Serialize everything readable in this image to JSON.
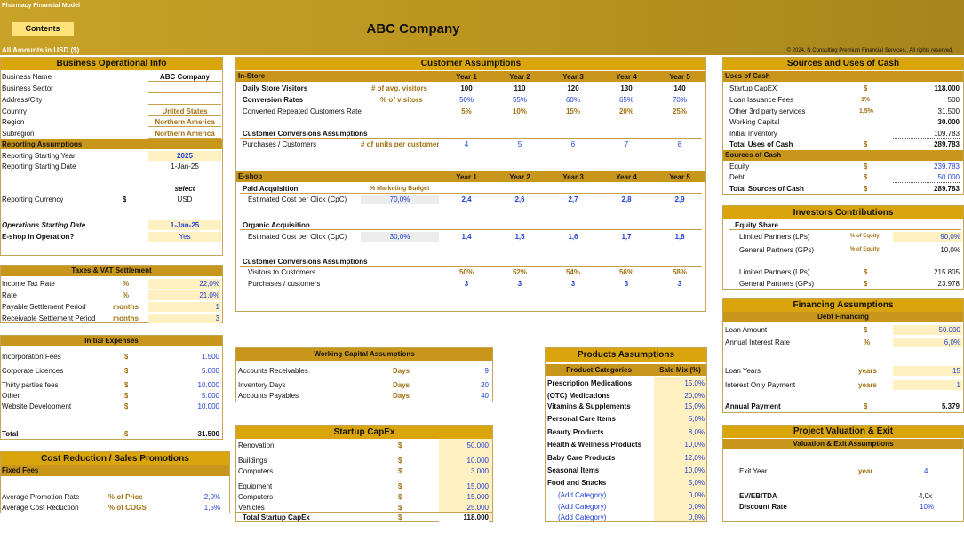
{
  "header": {
    "model_title": "Pharmacy Financial Model",
    "contents_btn": "Contents",
    "company": "ABC Company",
    "currency_note": "All Amounts in  USD ($)",
    "copyright": "© 2024, N Consulting Premium Financial Services.. All rights reserved."
  },
  "bop": {
    "title": "Business Operational Info",
    "l1": "Business Name",
    "v1": "ABC Company",
    "l2": "Business Sector",
    "l3": "Address/City",
    "l4": "Country",
    "v4": "United States",
    "l5": "Region",
    "v5": "Northern America",
    "l6": "Subregion",
    "v6": "Northern America",
    "rep_hdr": "Reporting Assumptions",
    "l7": "Reporting Starting Year",
    "v7": "2025",
    "l8": "Reporting Starting Date",
    "v8": "1-Jan-25",
    "select": "select",
    "l9": "Reporting Currency",
    "sym9": "$",
    "v9": "USD",
    "l10": "Operations Starting Date",
    "v10": "1-Jan-25",
    "l11": "E-shop in Operation?",
    "v11": "Yes"
  },
  "tax": {
    "title": "Taxes & VAT Settlement",
    "l1": "Income Tax Rate",
    "u1": "%",
    "v1": "22,0%",
    "l2": "Rate",
    "u2": "%",
    "v2": "21,0%",
    "l3": "Payable Settlement Period",
    "u3": "months",
    "v3": "1",
    "l4": "Receivable Settlement Period",
    "u4": "months",
    "v4": "3"
  },
  "ie": {
    "title": "Initial Expenses",
    "l1": "Incorporation Fees",
    "s1": "$",
    "v1": "1.500",
    "l2": "Corporate Licences",
    "s2": "$",
    "v2": "5.000",
    "l3": "Thirty parties fees",
    "s3": "$",
    "v3": "10.000",
    "l4": "Other",
    "s4": "$",
    "v4": "5.000",
    "l5": "Website Development",
    "s5": "$",
    "v5": "10.000",
    "total_label": "Total",
    "total_sym": "$",
    "total": "31.500"
  },
  "cr": {
    "title": "Cost Reduction / Sales Promotions",
    "sub": "Fixed Fees",
    "l1": "Average Promotion Rate",
    "u1": "% of Price",
    "v1": "2,0%",
    "l2": "Average Cost Reduction",
    "u2": "% of COGS",
    "v2": "1,5%"
  },
  "ca": {
    "title": "Customer Assumptions",
    "instore": "In-Store",
    "years": [
      "Year 1",
      "Year 2",
      "Year 3",
      "Year 4",
      "Year 5"
    ],
    "r1": {
      "label": "Daily Store Visitors",
      "unit": "# of  avg. visitors",
      "vals": [
        "100",
        "110",
        "120",
        "130",
        "140"
      ]
    },
    "r2": {
      "label": "Conversion Rates",
      "unit": "% of visitors",
      "vals": [
        "50%",
        "55%",
        "60%",
        "65%",
        "70%"
      ]
    },
    "r3": {
      "label": "Converted Repeated Customers Rate",
      "vals": [
        "5%",
        "10%",
        "15%",
        "20%",
        "25%"
      ]
    },
    "cca": "Customer Conversions Assumptions",
    "r4": {
      "label": "Purchases / Customers",
      "unit": "# of units per customer",
      "vals": [
        "4",
        "5",
        "6",
        "7",
        "8"
      ]
    },
    "eshop": "E-shop",
    "paid": "Paid Acquisition",
    "pct_budget": "% Marketing Budget",
    "r5": {
      "label": "Estimated Cost per Click (CpC)",
      "pct": "70,0%",
      "vals": [
        "2,4",
        "2,6",
        "2,7",
        "2,8",
        "2,9"
      ]
    },
    "organic": "Organic Acquisition",
    "r6": {
      "label": "Estimated Cost per Click (CpC)",
      "pct": "30,0%",
      "vals": [
        "1,4",
        "1,5",
        "1,6",
        "1,7",
        "1,8"
      ]
    },
    "cca2": "Customer Conversions Assumptions",
    "r7": {
      "label": "Visitors to Customers",
      "vals": [
        "50%",
        "52%",
        "54%",
        "56%",
        "58%"
      ]
    },
    "r8": {
      "label": "Purchases / customers",
      "vals": [
        "3",
        "3",
        "3",
        "3",
        "3"
      ]
    }
  },
  "wc": {
    "title": "Working Capital Assumptions",
    "l1": "Accounts Receivables",
    "u1": "Days",
    "v1": "9",
    "l2": "Inventory Days",
    "u2": "Days",
    "v2": "20",
    "l3": "Accounts Payables",
    "u3": "Days",
    "v3": "40"
  },
  "sc": {
    "title": "Startup CapEx",
    "l1": "Renovation",
    "v1": "50.000",
    "l2": "Buildings",
    "v2": "10.000",
    "l3": "Computers",
    "v3": "3.000",
    "l4": "Equipment",
    "v4": "15.000",
    "l5": "Computers",
    "v5": "15.000",
    "l6": "Vehicles",
    "v6": "25.000",
    "sym": "$",
    "total_label": "Total Startup CapEx",
    "total": "118.000"
  },
  "pa": {
    "title": "Products Assumptions",
    "col1": "Product Categories",
    "col2": "Sale Mix (%)",
    "items": [
      {
        "n": "Prescription Medications",
        "v": "15,0%"
      },
      {
        "n": "(OTC) Medications",
        "v": "20,0%"
      },
      {
        "n": "Vitamins & Supplements",
        "v": "15,0%"
      },
      {
        "n": "Personal Care Items",
        "v": "5,0%"
      },
      {
        "n": "Beauty Products",
        "v": "8,0%"
      },
      {
        "n": "Health & Wellness Products",
        "v": "10,0%"
      },
      {
        "n": "Baby Care Products",
        "v": "12,0%"
      },
      {
        "n": "Seasonal Items",
        "v": "10,0%"
      },
      {
        "n": "Food and Snacks",
        "v": "5,0%"
      },
      {
        "n": "(Add Category)",
        "v": "0,0%"
      },
      {
        "n": "(Add Category)",
        "v": "0,0%"
      },
      {
        "n": "(Add Category)",
        "v": "0,0%"
      }
    ]
  },
  "su": {
    "title": "Sources and Uses of Cash",
    "uses": "Uses of Cash",
    "l1": "Startup CapEX",
    "s1": "$",
    "v1": "118.000",
    "l2": "Loan Issuance Fees",
    "s2": "1%",
    "v2": "500",
    "l3": "Other 3rd party services",
    "s3": "1,5%",
    "v3": "31.500",
    "l4": "Working Capital",
    "v4": "30.000",
    "l5": "Initial Inventory",
    "v5": "109.783",
    "l6": "Total Uses of Cash",
    "s6": "$",
    "v6": "289.783",
    "sources": "Sources of Cash",
    "l7": "Equity",
    "s7": "$",
    "v7": "239.783",
    "l8": "Debt",
    "s8": "$",
    "v8": "50.000",
    "l9": "Total Sources of Cash",
    "s9": "$",
    "v9": "289.783"
  },
  "inv": {
    "title": "Investors Contributions",
    "sub": "Equity Share",
    "l1": "Limited Partners (LPs)",
    "u1": "% of Equity",
    "v1": "90,0%",
    "l2": "General Partners (GPs)",
    "u2": "% of Equity",
    "v2": "10,0%",
    "l3": "Limited Partners (LPs)",
    "s3": "$",
    "v3": "215.805",
    "l4": "General Partners (GPs)",
    "s4": "$",
    "v4": "23.978"
  },
  "fin": {
    "title": "Financing Assumptions",
    "sub": "Debt Financing",
    "l1": "Loan Amount",
    "u1": "$",
    "v1": "50.000",
    "l2": "Annual Interest Rate",
    "u2": "%",
    "v2": "6,0%",
    "l3": "Loan Years",
    "u3": "years",
    "v3": "15",
    "l4": "Interest Only Payment",
    "u4": "years",
    "v4": "1",
    "l5": "Annual Payment",
    "u5": "$",
    "v5": "5.379"
  },
  "pv": {
    "title": "Project Valuation & Exit",
    "sub": "Valuation & Exit Assumptions",
    "l1": "Exit Year",
    "u1": "year",
    "v1": "4",
    "l2": "EV/EBITDA",
    "v2": "4,0x",
    "l3": "Discount Rate",
    "v3": "10%"
  }
}
